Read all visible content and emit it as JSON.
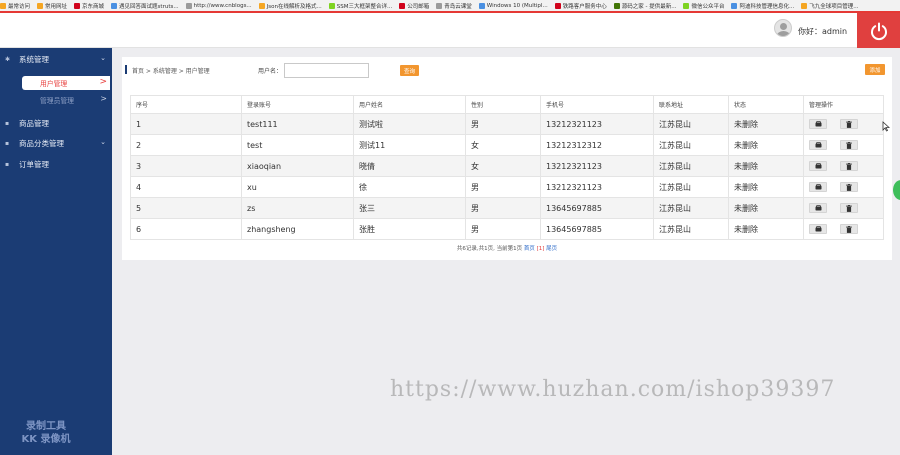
{
  "bookmarks": [
    {
      "label": "最常访问",
      "color": "#f5a623"
    },
    {
      "label": "常用网址",
      "color": "#f5a623"
    },
    {
      "label": "京东商城",
      "color": "#d0021b"
    },
    {
      "label": "遇见回答面试题struts...",
      "color": "#4a90e2"
    },
    {
      "label": "http://www.cnblogs...",
      "color": "#9b9b9b"
    },
    {
      "label": "Json在线解析及格式...",
      "color": "#f5a623"
    },
    {
      "label": "SSM三大框架整合详...",
      "color": "#7ed321"
    },
    {
      "label": "公司邮箱",
      "color": "#d0021b"
    },
    {
      "label": "青岛云课堂",
      "color": "#9b9b9b"
    },
    {
      "label": "Windows 10 (Multipl...",
      "color": "#4a90e2"
    },
    {
      "label": "铁路客户服务中心",
      "color": "#d0021b"
    },
    {
      "label": "源码之家 - 提供最新...",
      "color": "#417505"
    },
    {
      "label": "微信公众平台",
      "color": "#7ed321"
    },
    {
      "label": "阿迪科技管理信息化...",
      "color": "#4a90e2"
    },
    {
      "label": "飞九全球项目管理...",
      "color": "#f5a623"
    }
  ],
  "header": {
    "greeting": "你好：admin"
  },
  "sidebar": {
    "system": "系统管理",
    "user_mgmt": "用户管理",
    "admin_mgmt": "管理员管理",
    "goods": "商品管理",
    "category": "商品分类管理",
    "orders": "订单管理",
    "arrow": ">",
    "tool_line1": "录制工具",
    "tool_line2": "KK 录像机"
  },
  "content": {
    "breadcrumb": "首页 > 系统管理 > 用户管理",
    "filter_label": "用户名：",
    "filter_value": "",
    "search_label": "查询",
    "add_label": "添加",
    "columns": [
      "序号",
      "登录账号",
      "用户姓名",
      "性别",
      "手机号",
      "联系地址",
      "状态",
      "管理操作"
    ],
    "rows": [
      {
        "no": "1",
        "account": "test111",
        "name": "测试啦",
        "gender": "男",
        "phone": "13212321123",
        "address": "江苏昆山",
        "status": "未删除"
      },
      {
        "no": "2",
        "account": "test",
        "name": "测试11",
        "gender": "女",
        "phone": "13212312312",
        "address": "江苏昆山",
        "status": "未删除"
      },
      {
        "no": "3",
        "account": "xiaoqian",
        "name": "晓倩",
        "gender": "女",
        "phone": "13212321123",
        "address": "江苏昆山",
        "status": "未删除"
      },
      {
        "no": "4",
        "account": "xu",
        "name": "徐",
        "gender": "男",
        "phone": "13212321123",
        "address": "江苏昆山",
        "status": "未删除"
      },
      {
        "no": "5",
        "account": "zs",
        "name": "张三",
        "gender": "男",
        "phone": "13645697885",
        "address": "江苏昆山",
        "status": "未删除"
      },
      {
        "no": "6",
        "account": "zhangsheng",
        "name": "张胜",
        "gender": "男",
        "phone": "13645697885",
        "address": "江苏昆山",
        "status": "未删除"
      }
    ],
    "pager": {
      "info": "共6记录,共1页, 当前第1页",
      "first": "首页",
      "current": "[1]",
      "last": "尾页"
    }
  },
  "watermark": "https://www.huzhan.com/ishop39397",
  "icons": {
    "power": "power-icon",
    "avatar": "user-avatar",
    "edit": "edit-icon",
    "delete": "trash-icon"
  },
  "colors": {
    "sidebar": "#1b3c74",
    "accent_red": "#e0403f",
    "button_orange": "#f2962f",
    "link_blue": "#2d6bc9"
  }
}
